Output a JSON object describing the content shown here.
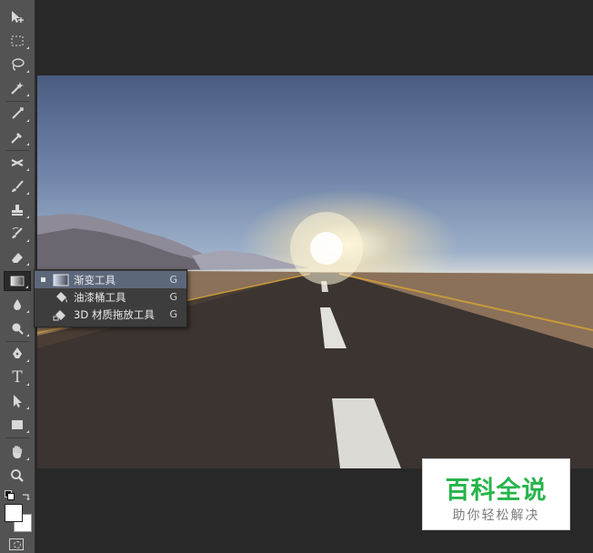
{
  "toolbar": {
    "tools": [
      {
        "name": "move-tool",
        "icon": "move-icon"
      },
      {
        "name": "marquee-tool",
        "icon": "marquee-icon"
      },
      {
        "name": "lasso-tool",
        "icon": "lasso-icon"
      },
      {
        "name": "magic-wand-tool",
        "icon": "magic-wand-icon"
      },
      {
        "name": "crop-tool",
        "icon": "crop-icon"
      },
      {
        "name": "eyedropper-tool",
        "icon": "eyedropper-icon"
      },
      {
        "name": "healing-tool",
        "icon": "healing-brush-icon"
      },
      {
        "name": "brush-tool",
        "icon": "brush-icon"
      },
      {
        "name": "stamp-tool",
        "icon": "clone-stamp-icon"
      },
      {
        "name": "history-brush-tool",
        "icon": "history-brush-icon"
      },
      {
        "name": "eraser-tool",
        "icon": "eraser-icon"
      },
      {
        "name": "gradient-tool",
        "icon": "gradient-icon",
        "active": true
      },
      {
        "name": "blur-tool",
        "icon": "blur-drop-icon"
      },
      {
        "name": "dodge-tool",
        "icon": "dodge-icon"
      },
      {
        "name": "pen-tool",
        "icon": "pen-icon"
      },
      {
        "name": "type-tool",
        "icon": "type-icon",
        "glyph": "T"
      },
      {
        "name": "path-selection-tool",
        "icon": "path-select-arrow-icon"
      },
      {
        "name": "shape-tool",
        "icon": "rectangle-icon"
      },
      {
        "name": "hand-tool",
        "icon": "hand-icon"
      },
      {
        "name": "zoom-tool",
        "icon": "zoom-icon"
      }
    ]
  },
  "flyout": {
    "items": [
      {
        "label": "渐变工具",
        "shortcut": "G",
        "icon": "gradient-icon",
        "selected": true
      },
      {
        "label": "油漆桶工具",
        "shortcut": "G",
        "icon": "paint-bucket-icon",
        "selected": false
      },
      {
        "label": "3D 材质拖放工具",
        "shortcut": "G",
        "icon": "3d-material-drop-icon",
        "selected": false
      }
    ]
  },
  "watermark": {
    "title": "百科全说",
    "subtitle": "助你轻松解决",
    "color": "#27b44a"
  },
  "colors": {
    "panel": "#535353",
    "workspace": "#282828",
    "menu_selected": "#5c677a"
  }
}
